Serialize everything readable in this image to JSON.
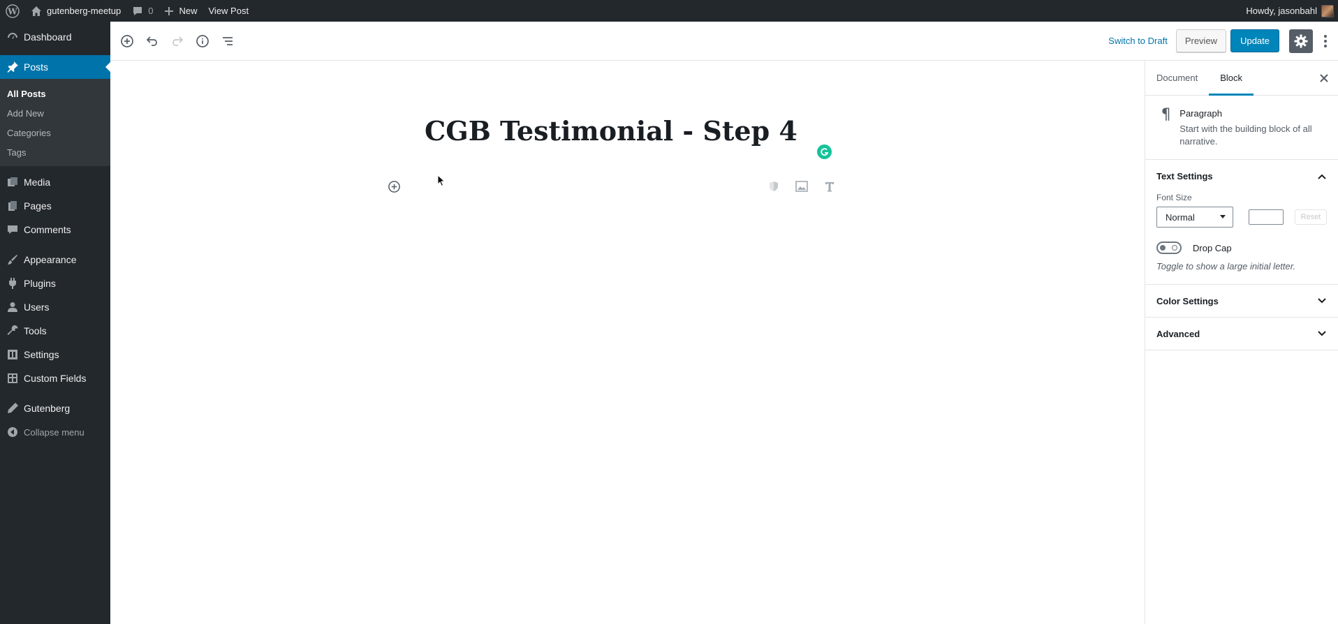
{
  "adminbar": {
    "site_name": "gutenberg-meetup",
    "comments_count": "0",
    "new_label": "New",
    "view_post_label": "View Post",
    "howdy": "Howdy, jasonbahl"
  },
  "menu": {
    "dashboard": "Dashboard",
    "posts": "Posts",
    "posts_sub": [
      "All Posts",
      "Add New",
      "Categories",
      "Tags"
    ],
    "media": "Media",
    "pages": "Pages",
    "comments": "Comments",
    "appearance": "Appearance",
    "plugins": "Plugins",
    "users": "Users",
    "tools": "Tools",
    "settings": "Settings",
    "custom_fields": "Custom Fields",
    "gutenberg": "Gutenberg",
    "collapse": "Collapse menu"
  },
  "header": {
    "switch_to_draft": "Switch to Draft",
    "preview": "Preview",
    "update": "Update"
  },
  "editor": {
    "post_title": "CGB Testimonial - Step 4"
  },
  "panel": {
    "tabs": [
      "Document",
      "Block"
    ],
    "active_tab": "Block",
    "block": {
      "name": "Paragraph",
      "description": "Start with the building block of all narrative."
    },
    "text_settings": {
      "title": "Text Settings",
      "font_size_label": "Font Size",
      "font_size_value": "Normal",
      "custom_size_value": "",
      "reset_label": "Reset",
      "drop_cap_label": "Drop Cap",
      "drop_cap_enabled": false,
      "drop_cap_help": "Toggle to show a large initial letter."
    },
    "color_settings_title": "Color Settings",
    "advanced_title": "Advanced"
  },
  "colors": {
    "admin_dark": "#23282d",
    "accent_blue": "#0073aa",
    "primary_button": "#0085ba",
    "grammarly_green": "#15c39a"
  }
}
